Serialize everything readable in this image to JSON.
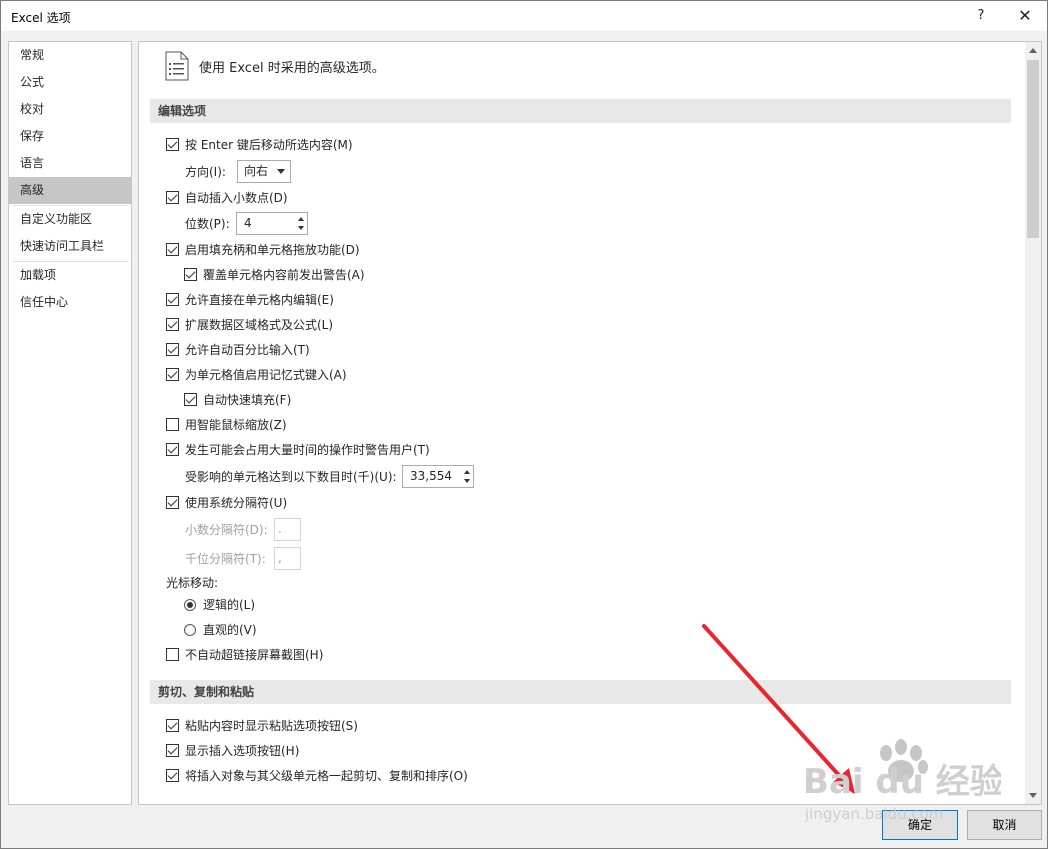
{
  "window": {
    "title": "Excel 选项",
    "help": "?",
    "close": "✕"
  },
  "sidebar": {
    "items": [
      {
        "label": "常规"
      },
      {
        "label": "公式"
      },
      {
        "label": "校对"
      },
      {
        "label": "保存"
      },
      {
        "label": "语言"
      },
      {
        "label": "高级"
      },
      {
        "label": "自定义功能区"
      },
      {
        "label": "快速访问工具栏"
      },
      {
        "label": "加载项"
      },
      {
        "label": "信任中心"
      }
    ],
    "active_index": 5
  },
  "content": {
    "header": "使用 Excel 时采用的高级选项。",
    "section_editing": "编辑选项",
    "section_clipboard": "剪切、复制和粘贴",
    "options": {
      "move_after_enter": {
        "label": "按 Enter 键后移动所选内容(M)",
        "checked": true
      },
      "direction_label": "方向(I):",
      "direction_value": "向右",
      "auto_decimal": {
        "label": "自动插入小数点(D)",
        "checked": true
      },
      "places_label": "位数(P):",
      "places_value": "4",
      "fill_handle": {
        "label": "启用填充柄和单元格拖放功能(D)",
        "checked": true
      },
      "alert_overwrite": {
        "label": "覆盖单元格内容前发出警告(A)",
        "checked": true
      },
      "edit_in_cell": {
        "label": "允许直接在单元格内编辑(E)",
        "checked": true
      },
      "extend_formats": {
        "label": "扩展数据区域格式及公式(L)",
        "checked": true
      },
      "auto_percent": {
        "label": "允许自动百分比输入(T)",
        "checked": true
      },
      "autocomplete": {
        "label": "为单元格值启用记忆式键入(A)",
        "checked": true
      },
      "flash_fill": {
        "label": "自动快速填充(F)",
        "checked": true
      },
      "zoom_intellimouse": {
        "label": "用智能鼠标缩放(Z)",
        "checked": false
      },
      "alert_time_consuming": {
        "label": "发生可能会占用大量时间的操作时警告用户(T)",
        "checked": true
      },
      "cells_affected_label": "受影响的单元格达到以下数目时(千)(U):",
      "cells_affected_value": "33,554",
      "system_separators": {
        "label": "使用系统分隔符(U)",
        "checked": true
      },
      "decimal_sep_label": "小数分隔符(D):",
      "decimal_sep_value": ".",
      "thousands_sep_label": "千位分隔符(T):",
      "thousands_sep_value": ",",
      "cursor_movement_label": "光标移动:",
      "cursor_logical": {
        "label": "逻辑的(L)",
        "checked": true
      },
      "cursor_visual": {
        "label": "直观的(V)",
        "checked": false
      },
      "no_auto_hyperlink": {
        "label": "不自动超链接屏幕截图(H)",
        "checked": false
      },
      "paste_options": {
        "label": "粘贴内容时显示粘贴选项按钮(S)",
        "checked": true
      },
      "insert_options": {
        "label": "显示插入选项按钮(H)",
        "checked": true
      },
      "cut_copy_sort": {
        "label": "将插入对象与其父级单元格一起剪切、复制和排序(O)",
        "checked": true
      }
    }
  },
  "buttons": {
    "ok": "确定",
    "cancel": "取消"
  },
  "annotation": {
    "arrow_color": "#e8262d"
  },
  "watermark": {
    "line1": "Bai du 经验",
    "line2": "jingyan.baidu.com"
  }
}
